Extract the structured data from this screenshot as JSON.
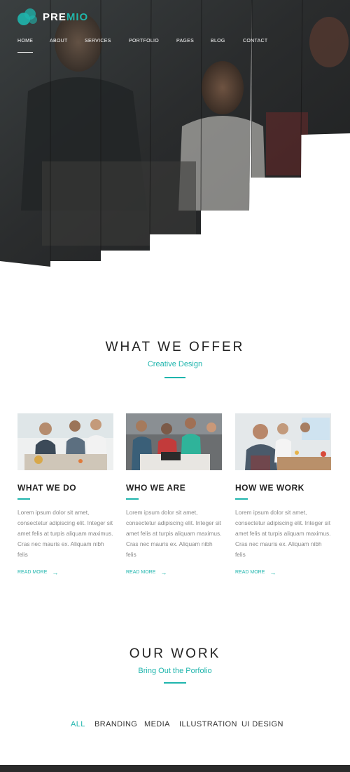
{
  "brand": {
    "name_part1": "PRE",
    "name_part2": "MIO",
    "accent_color": "#1fb5ad"
  },
  "nav": {
    "items": [
      {
        "label": "HOME",
        "active": true
      },
      {
        "label": "ABOUT"
      },
      {
        "label": "SERVICES"
      },
      {
        "label": "PORTFOLIO"
      },
      {
        "label": "PAGES"
      },
      {
        "label": "BLOG"
      },
      {
        "label": "CONTACT"
      }
    ]
  },
  "offer": {
    "title": "WHAT WE OFFER",
    "subtitle": "Creative Design",
    "cards": [
      {
        "title": "WHAT WE DO",
        "text": "Lorem ipsum dolor sit amet, consectetur adipiscing elit. Integer sit amet felis at turpis aliquam maximus. Cras nec mauris ex. Aliquam nibh felis",
        "link": "READ MORE"
      },
      {
        "title": "WHO WE ARE",
        "text": "Lorem ipsum dolor sit amet, consectetur adipiscing elit. Integer sit amet felis at turpis aliquam maximus. Cras nec mauris ex. Aliquam nibh felis",
        "link": "READ MORE"
      },
      {
        "title": "HOW WE WORK",
        "text": "Lorem ipsum dolor sit amet, consectetur adipiscing elit. Integer sit amet felis at turpis aliquam maximus. Cras nec mauris ex. Aliquam nibh felis",
        "link": "READ MORE"
      }
    ]
  },
  "work": {
    "title": "OUR WORK",
    "subtitle": "Bring Out the Porfolio",
    "filters": [
      {
        "label": "ALL",
        "active": true
      },
      {
        "label": "BRANDING"
      },
      {
        "label": "MEDIA"
      },
      {
        "label": "ILLUSTRATION"
      },
      {
        "label": "UI DESIGN"
      }
    ]
  },
  "icons": {
    "logo": "bubbles-icon",
    "read_more": "arrow-right-icon"
  }
}
